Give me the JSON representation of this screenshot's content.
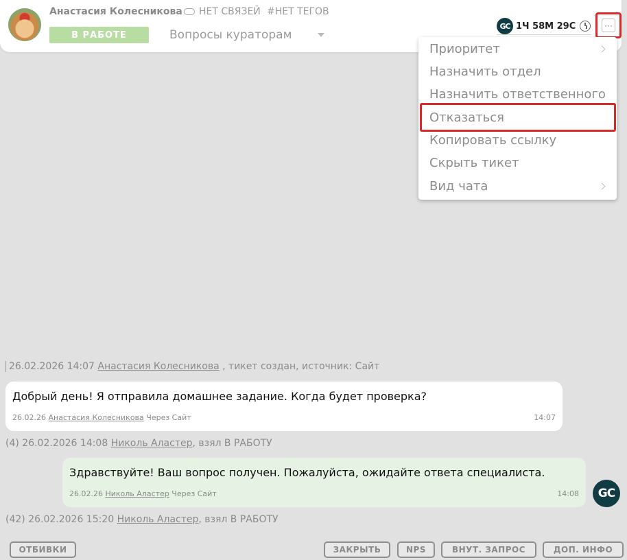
{
  "header": {
    "client_name": "Анастасия Колесникова",
    "links_label": "НЕТ СВЯЗЕЙ",
    "tags_label": "#НЕТ ТЕГОВ",
    "status_label": "В РАБОТЕ",
    "queue_value": "Вопросы кураторам",
    "timer_logo": "GC",
    "timer_value": "1Ч 58М 29С",
    "more_label": "···"
  },
  "menu": {
    "items": [
      {
        "label": "Приоритет",
        "submenu": true
      },
      {
        "label": "Назначить отдел",
        "submenu": false
      },
      {
        "label": "Назначить ответственного",
        "submenu": false
      },
      {
        "label": "Отказаться",
        "submenu": false
      },
      {
        "label": "Копировать ссылку",
        "submenu": false
      },
      {
        "label": "Скрыть тикет",
        "submenu": false
      },
      {
        "label": "Вид чата",
        "submenu": true
      }
    ]
  },
  "chat": {
    "event1": {
      "datetime": "26.02.2026 14:07",
      "user": "Анастасия Колесникова",
      "text": " , тикет создан, источник: Сайт"
    },
    "message1": {
      "text": "Добрый день! Я отправила домашнее задание. Когда будет проверка?",
      "date": "26.02.26",
      "author": "Анастасия Колесникова",
      "source": "Через Сайт",
      "time": "14:07"
    },
    "event2": {
      "count": "(4)",
      "datetime": "26.02.2026 14:08",
      "user": "Николь Аластер",
      "text": ", взял В РАБОТУ"
    },
    "message2": {
      "text": "Здравствуйте! Ваш вопрос получен. Пожалуйста, ожидайте ответа специалиста.",
      "date": "26.02.26",
      "author": "Николь Аластер",
      "source": "Через Сайт",
      "time": "14:08",
      "avatar": "GC"
    },
    "event3": {
      "count": "(42)",
      "datetime": "26.02.2026 15:20",
      "user": "Николь Аластер",
      "text": ", взял В РАБОТУ"
    }
  },
  "bottom": {
    "otbivki": "ОТБИВКИ",
    "close": "ЗАКРЫТЬ",
    "nps": "NPS",
    "internal": "ВНУТ. ЗАПРОС",
    "info": "ДОП. ИНФО"
  },
  "colors": {
    "accent_red": "#d42b2b",
    "status_green": "#b7dda2",
    "agent_bubble": "#e6f3e4",
    "logo_dark": "#123c44"
  }
}
